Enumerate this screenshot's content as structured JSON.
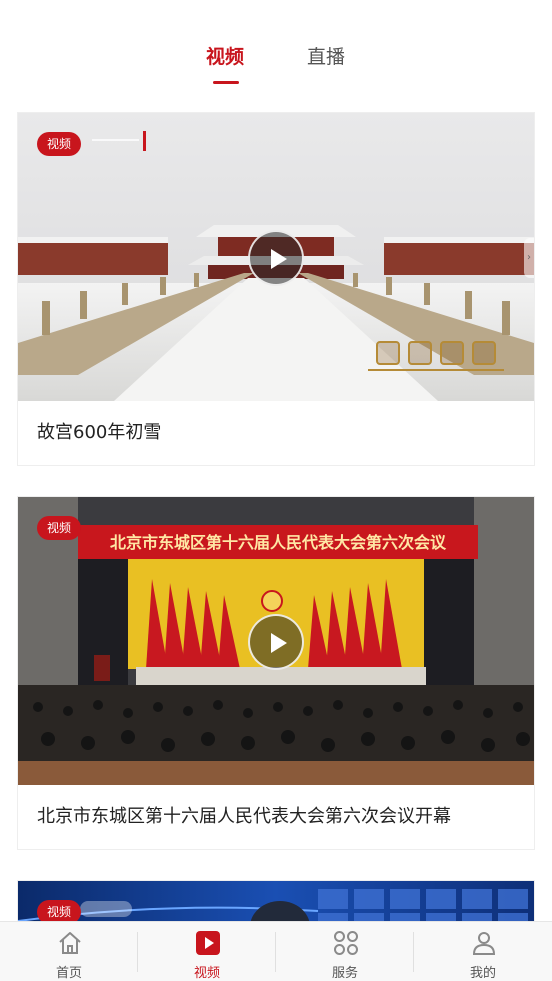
{
  "top_tabs": [
    {
      "label": "视频",
      "active": true
    },
    {
      "label": "直播",
      "active": false
    }
  ],
  "videos": [
    {
      "badge": "视频",
      "caption": "故宫600年初雪"
    },
    {
      "badge": "视频",
      "caption": "北京市东城区第十六届人民代表大会第六次会议开幕",
      "overlay_text": "北京市东城区第十六届人民代表大会第六次会议"
    },
    {
      "badge": "视频",
      "caption": ""
    }
  ],
  "bottom_nav": [
    {
      "label": "首页",
      "icon": "home-icon",
      "active": false
    },
    {
      "label": "视频",
      "icon": "video-play-icon",
      "active": true
    },
    {
      "label": "服务",
      "icon": "grid-services-icon",
      "active": false
    },
    {
      "label": "我的",
      "icon": "user-icon",
      "active": false
    }
  ],
  "colors": {
    "accent": "#c8151d",
    "background": "#ffffff",
    "nav_background": "#f8f8f8",
    "inactive_text": "#555555"
  }
}
